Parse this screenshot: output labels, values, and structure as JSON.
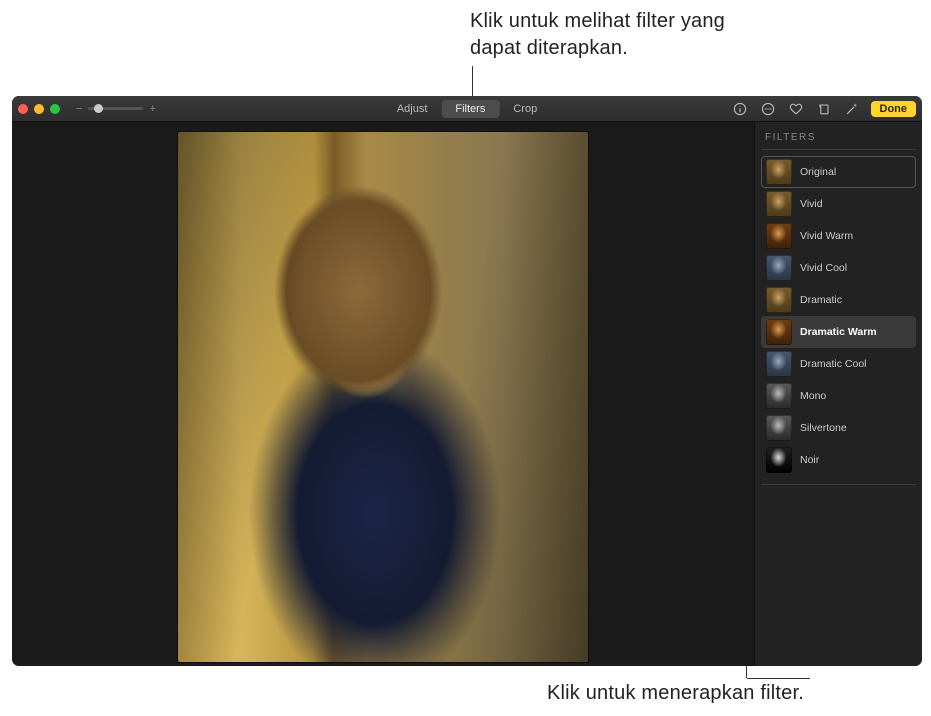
{
  "annotations": {
    "top": "Klik untuk melihat filter yang dapat diterapkan.",
    "bottom": "Klik untuk menerapkan filter."
  },
  "toolbar": {
    "zoom_minus": "−",
    "zoom_plus": "+",
    "tabs": {
      "adjust": "Adjust",
      "filters": "Filters",
      "crop": "Crop"
    },
    "done": "Done"
  },
  "sidebar": {
    "title": "FILTERS",
    "filters": [
      {
        "label": "Original",
        "variant": "orig",
        "selected": false,
        "boxed": true
      },
      {
        "label": "Vivid",
        "variant": "orig",
        "selected": false,
        "boxed": false
      },
      {
        "label": "Vivid Warm",
        "variant": "warm",
        "selected": false,
        "boxed": false
      },
      {
        "label": "Vivid Cool",
        "variant": "cool",
        "selected": false,
        "boxed": false
      },
      {
        "label": "Dramatic",
        "variant": "orig",
        "selected": false,
        "boxed": false
      },
      {
        "label": "Dramatic Warm",
        "variant": "warm",
        "selected": true,
        "boxed": false
      },
      {
        "label": "Dramatic Cool",
        "variant": "cool",
        "selected": false,
        "boxed": false
      },
      {
        "label": "Mono",
        "variant": "mono",
        "selected": false,
        "boxed": false
      },
      {
        "label": "Silvertone",
        "variant": "mono",
        "selected": false,
        "boxed": false
      },
      {
        "label": "Noir",
        "variant": "noir",
        "selected": false,
        "boxed": false
      }
    ]
  }
}
